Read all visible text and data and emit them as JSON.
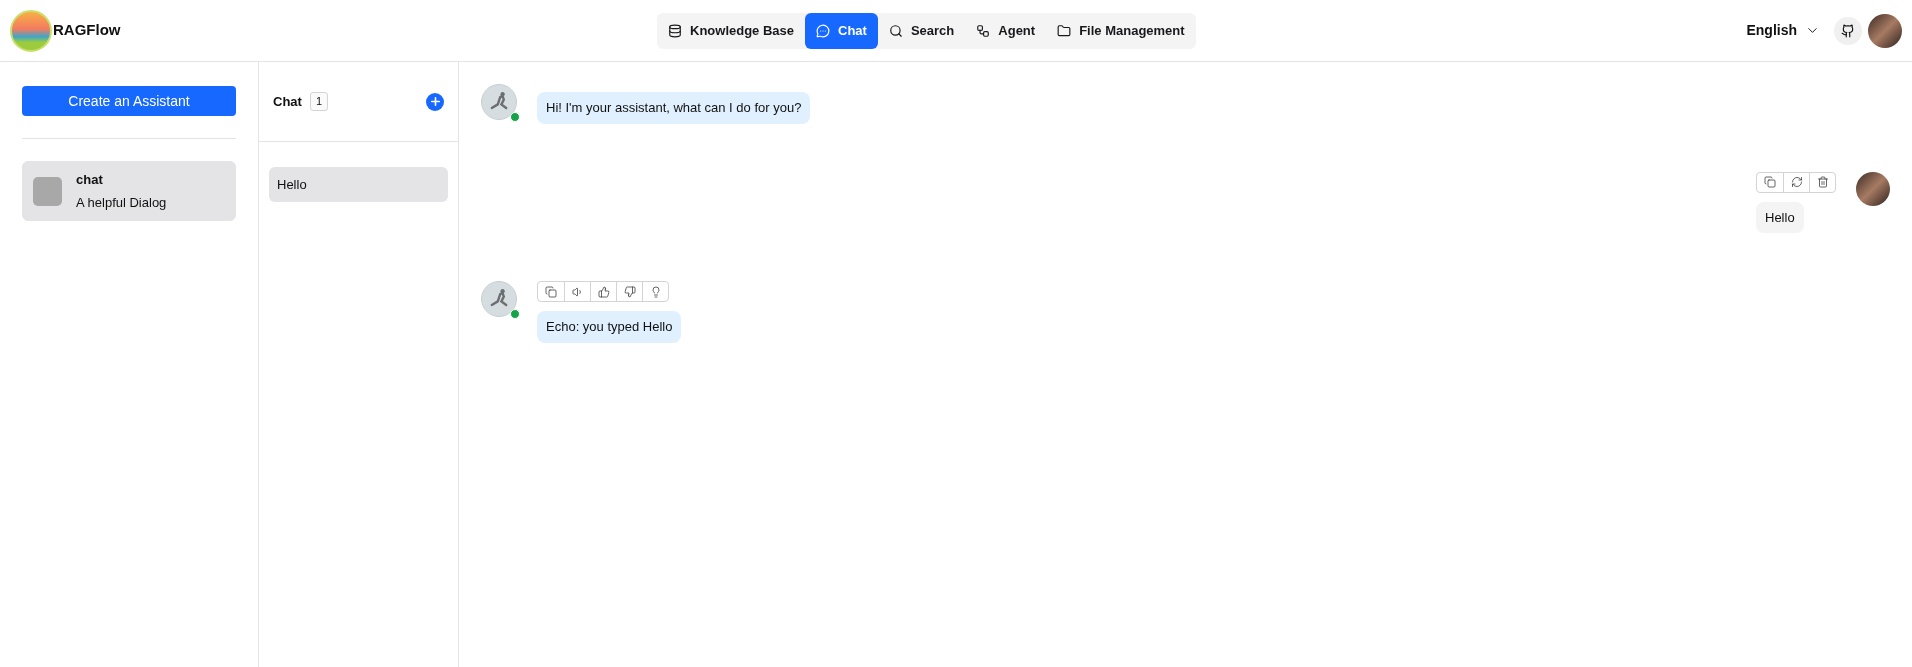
{
  "header": {
    "brand": "RAGFlow",
    "nav": [
      {
        "label": "Knowledge Base",
        "selected": false
      },
      {
        "label": "Chat",
        "selected": true
      },
      {
        "label": "Search",
        "selected": false
      },
      {
        "label": "Agent",
        "selected": false
      },
      {
        "label": "File Management",
        "selected": false
      }
    ],
    "language": "English"
  },
  "assistants_panel": {
    "create_button": "Create an Assistant",
    "assistants": [
      {
        "name": "chat",
        "description": "A helpful Dialog",
        "selected": true
      }
    ]
  },
  "conversations_panel": {
    "title": "Chat",
    "count": "1",
    "conversations": [
      {
        "title": "Hello",
        "selected": true
      }
    ]
  },
  "messages": [
    {
      "kind": "assistant",
      "text": "Hi! I'm your assistant, what can I do for you?",
      "toolbar": false
    },
    {
      "kind": "user",
      "text": "Hello",
      "toolbar": true
    },
    {
      "kind": "assistant",
      "text": "Echo: you typed Hello",
      "toolbar": true
    }
  ]
}
